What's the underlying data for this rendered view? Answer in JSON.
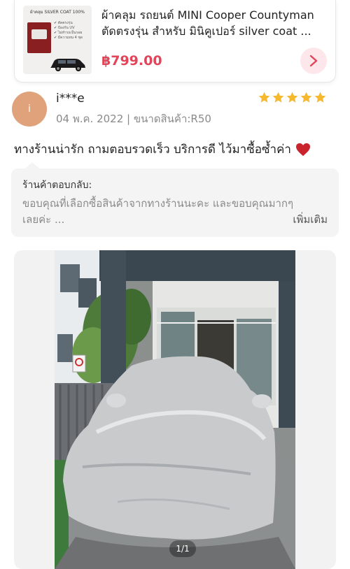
{
  "product": {
    "thumb_title": "ผ้าคลุม SILVER COAT 100%",
    "thumb_badges": "✔ ตัดตรงรุ่น\n✔ ป้องกัน UV\n✔ ไม่ทำรถเป็นรอย\n✔ มีความทน 4 ชุด",
    "title_line1": "ผ้าคลุม รถยนต์ MINI Cooper Countyman",
    "title_line2": "ตัดตรงรุ่น สำหรับ มินิคูเปอร์ silver coat ...",
    "price": "฿799.00",
    "accent_color": "#e2445a"
  },
  "review": {
    "avatar_letter": "i",
    "username": "i***e",
    "meta": "04 พ.ค. 2022 | ขนาดสินค้า:R50",
    "rating": 5,
    "text": "ทางร้านน่ารัก ถามตอบรวดเร็ว บริการดี ไว้มาซื้อซ้ำค่า",
    "star_color": "#f5b82e"
  },
  "shop_reply": {
    "label": "ร้านค้าตอบกลับ:",
    "line1": "ขอบคุณที่เลือกซื้อสินค้าจากทางร้านนะคะ และขอบคุณมากๆ",
    "line2": "เลยค่ะ ...",
    "more": "เพิ่มเติม"
  },
  "photo": {
    "counter": "1/1"
  }
}
